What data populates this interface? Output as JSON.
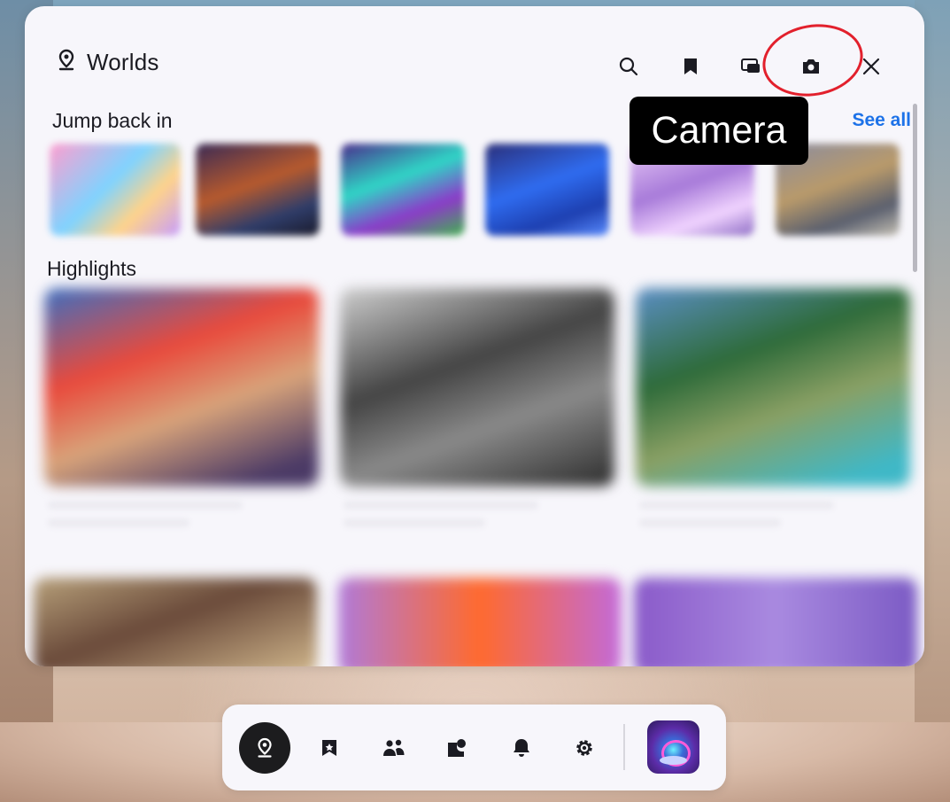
{
  "panel": {
    "title": "Worlds",
    "tooltip": "Camera",
    "header_icons": [
      "search-icon",
      "bookmark-icon",
      "screen-cast-icon",
      "camera-icon",
      "close-icon"
    ],
    "accent_color": "#1d72e8",
    "highlight_circle_color": "#e2202c"
  },
  "jump_back_in": {
    "title": "Jump back in",
    "see_all": "See all"
  },
  "highlights": {
    "title": "Highlights"
  },
  "dock": {
    "items": [
      "worlds-icon",
      "saved-icon",
      "people-icon",
      "social-icon",
      "notifications-icon",
      "settings-icon"
    ],
    "active_item": "worlds-icon"
  }
}
